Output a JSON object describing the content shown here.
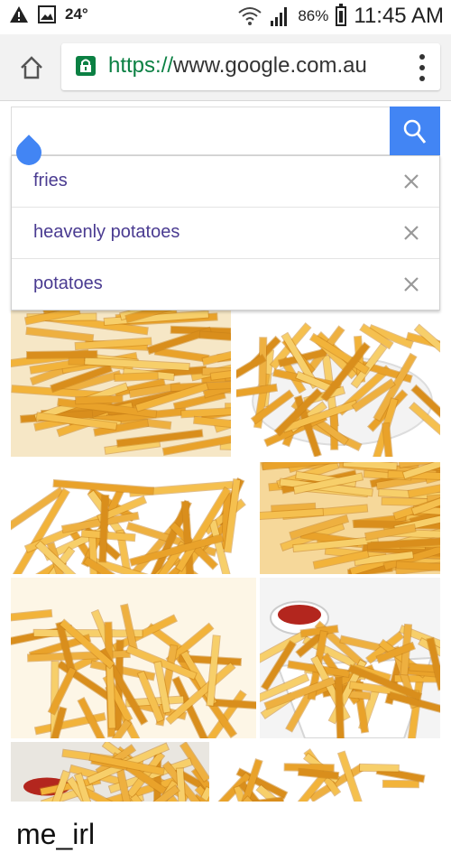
{
  "status_bar": {
    "temperature": "24°",
    "battery": "86%",
    "time": "11:45 AM"
  },
  "url_bar": {
    "scheme": "https://",
    "host": "www.google.com.au"
  },
  "search": {
    "query": ""
  },
  "suggestions": [
    {
      "label": "fries"
    },
    {
      "label": "heavenly potatoes"
    },
    {
      "label": "potatoes"
    }
  ],
  "images": [
    {
      "subject": "fries-pile"
    },
    {
      "subject": "fries-on-plate"
    },
    {
      "subject": "fries-pile"
    },
    {
      "subject": "fries-close-up"
    },
    {
      "subject": "fries-close-up"
    },
    {
      "subject": "fries-with-ketchup"
    },
    {
      "subject": "fries-with-ketchup"
    },
    {
      "subject": "fries-scattered"
    }
  ],
  "caption": "me_irl",
  "colors": {
    "accent": "#4285f4",
    "secure": "#0b8043",
    "suggestion_text": "#4a3b91",
    "fry": "#f2b33a"
  }
}
